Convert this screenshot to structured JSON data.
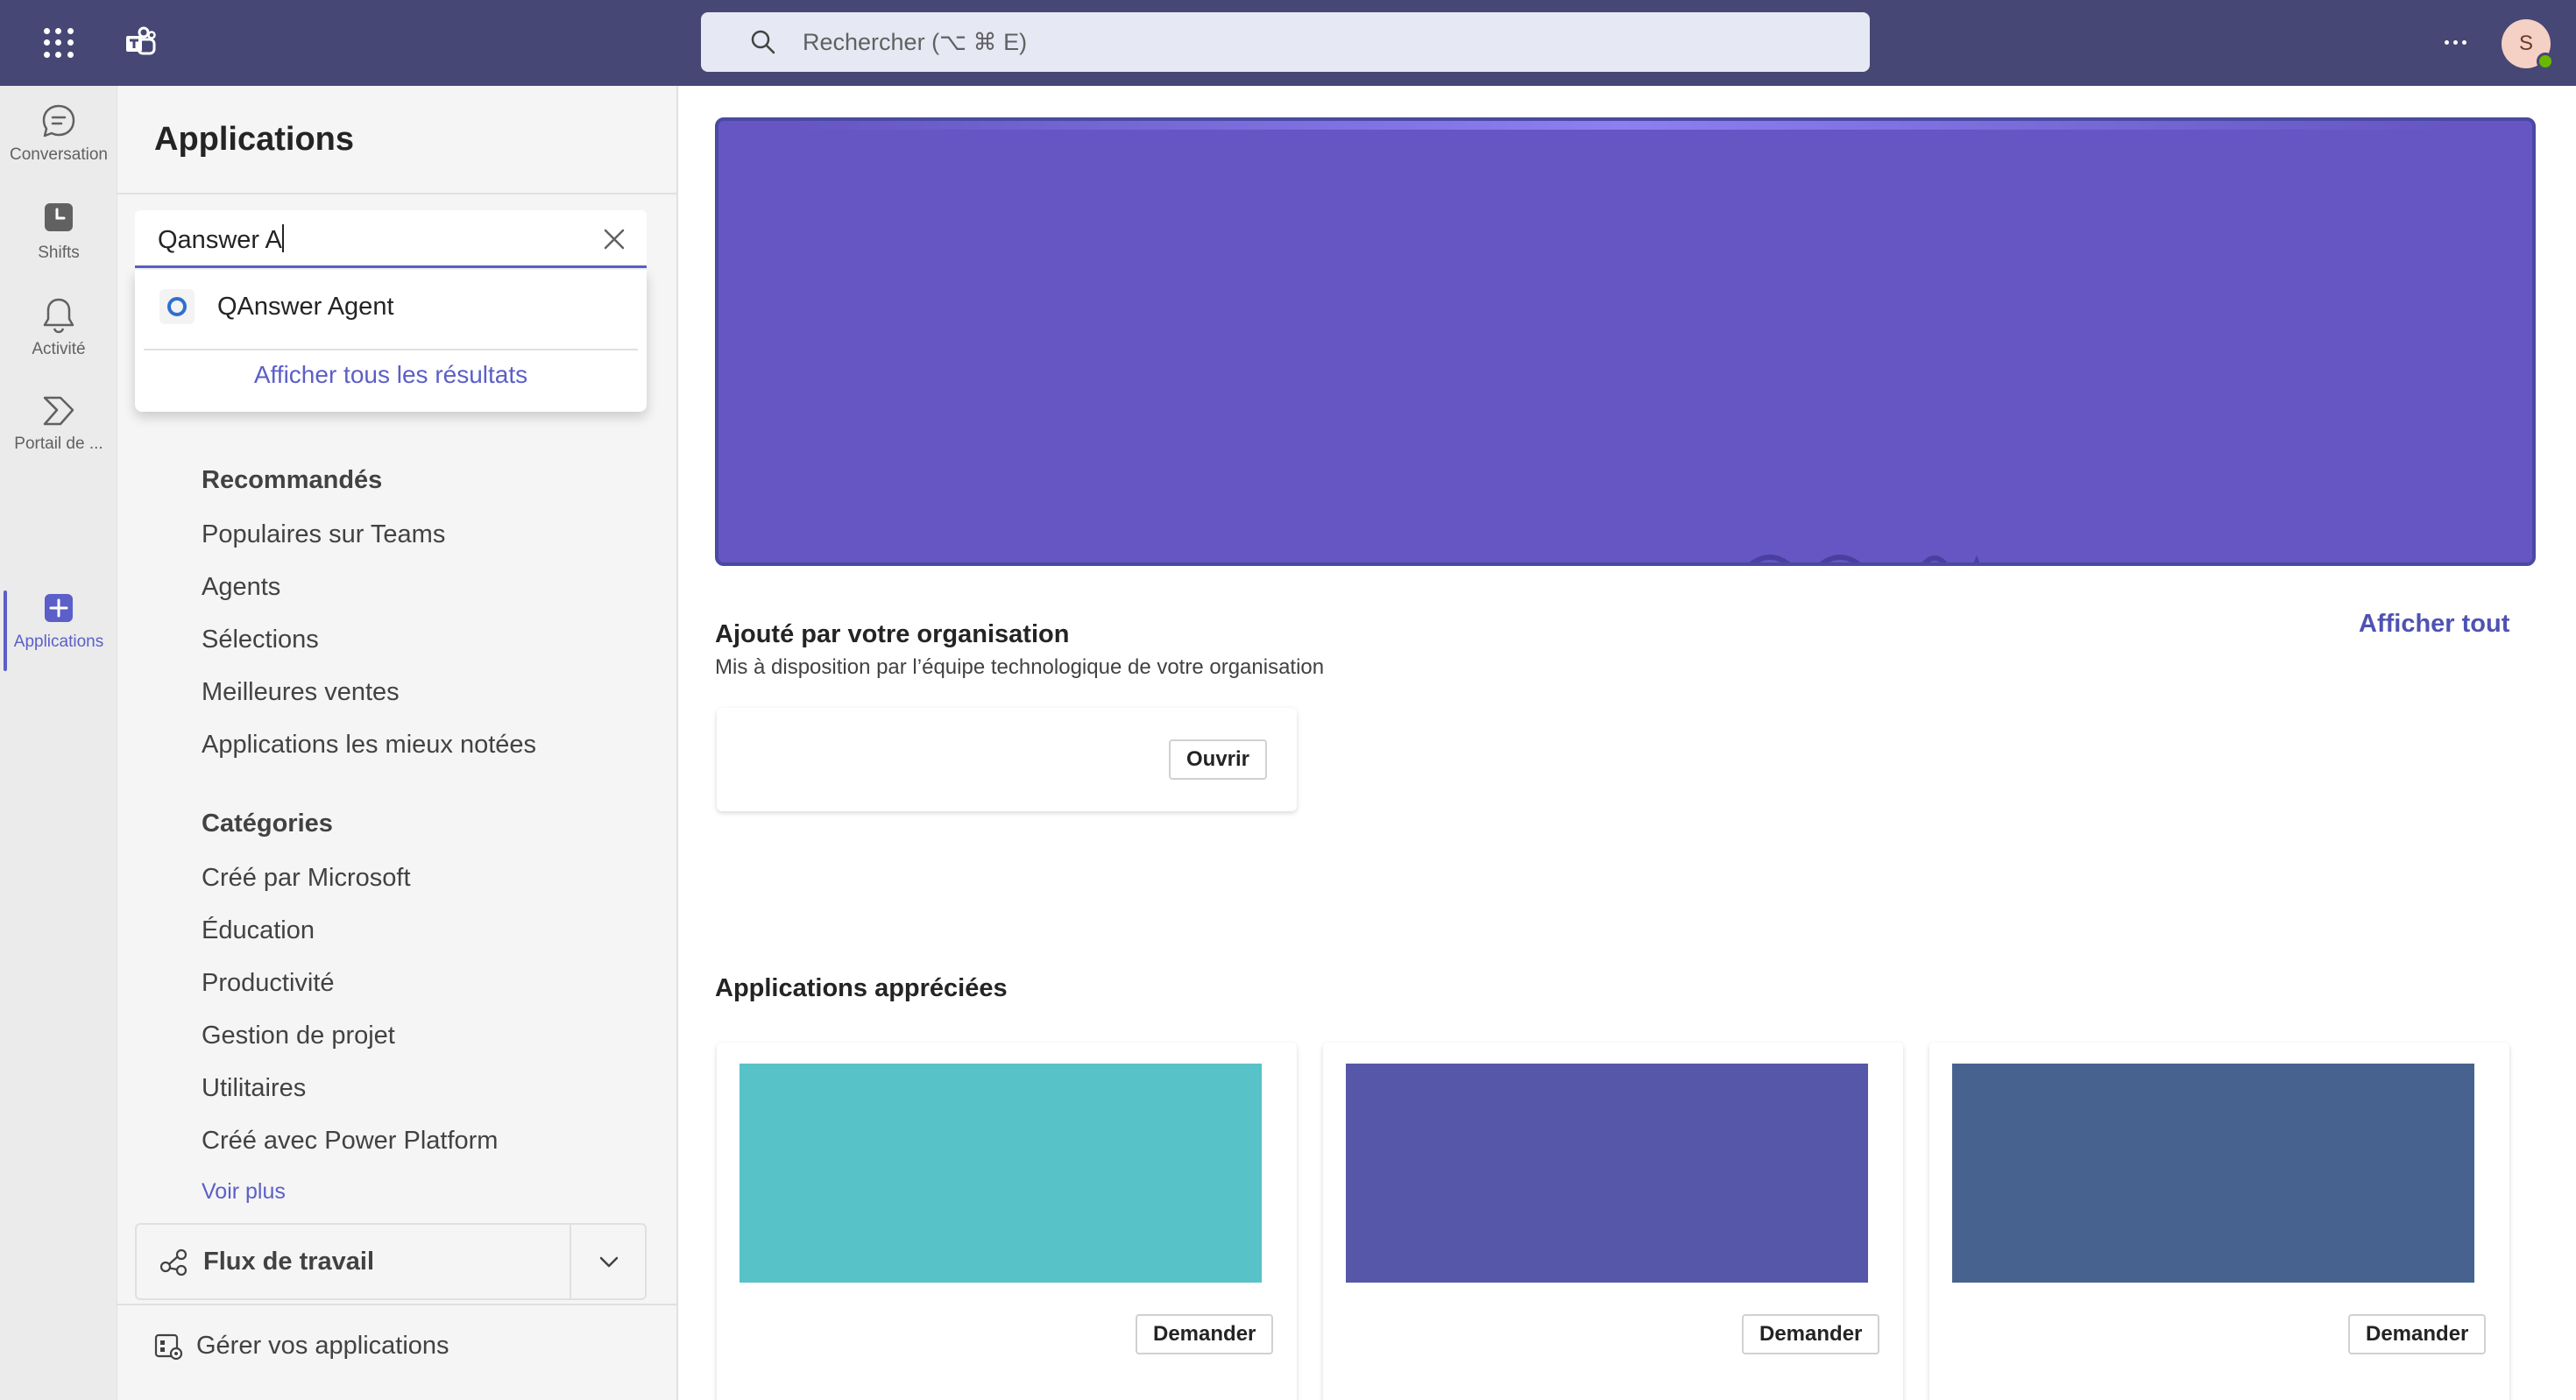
{
  "topbar": {
    "search_placeholder": "Rechercher (⌥ ⌘ E)",
    "avatar_initial": "S"
  },
  "rail": {
    "items": [
      {
        "label": "Conversation",
        "icon": "chat-icon"
      },
      {
        "label": "Shifts",
        "icon": "shifts-icon"
      },
      {
        "label": "Activité",
        "icon": "bell-icon"
      },
      {
        "label": "Portail de ...",
        "icon": "portal-icon"
      },
      {
        "label": "Applications",
        "icon": "apps-plus-icon",
        "active": true
      }
    ]
  },
  "pane": {
    "title": "Applications",
    "search_value": "Qanswer A",
    "dropdown": {
      "result_label": "QAnswer Agent",
      "show_all": "Afficher tous les résultats"
    },
    "recommended_header": "Recommandés",
    "recommended": [
      "Populaires sur Teams",
      "Agents",
      "Sélections",
      "Meilleures ventes",
      "Applications les mieux notées"
    ],
    "categories_header": "Catégories",
    "categories": [
      "Créé par Microsoft",
      "Éducation",
      "Productivité",
      "Gestion de projet",
      "Utilitaires",
      "Créé avec Power Platform"
    ],
    "see_more": "Voir plus",
    "workflow_label": "Flux de travail",
    "manage_label": "Gérer vos applications"
  },
  "main": {
    "org_section": {
      "title": "Ajouté par votre organisation",
      "subtitle": "Mis à disposition par l’équipe technologique de votre organisation",
      "see_all": "Afficher tout",
      "open_button": "Ouvrir"
    },
    "liked_section": {
      "title": "Applications appréciées",
      "cards": [
        {
          "button": "Demander",
          "color": "#57c2c8"
        },
        {
          "button": "Demander",
          "color": "#5657a8"
        },
        {
          "button": "Demander",
          "color": "#48628f"
        }
      ]
    }
  },
  "colors": {
    "topbar": "#464775",
    "accent": "#5b5fc7",
    "banner": "#6556c3"
  }
}
